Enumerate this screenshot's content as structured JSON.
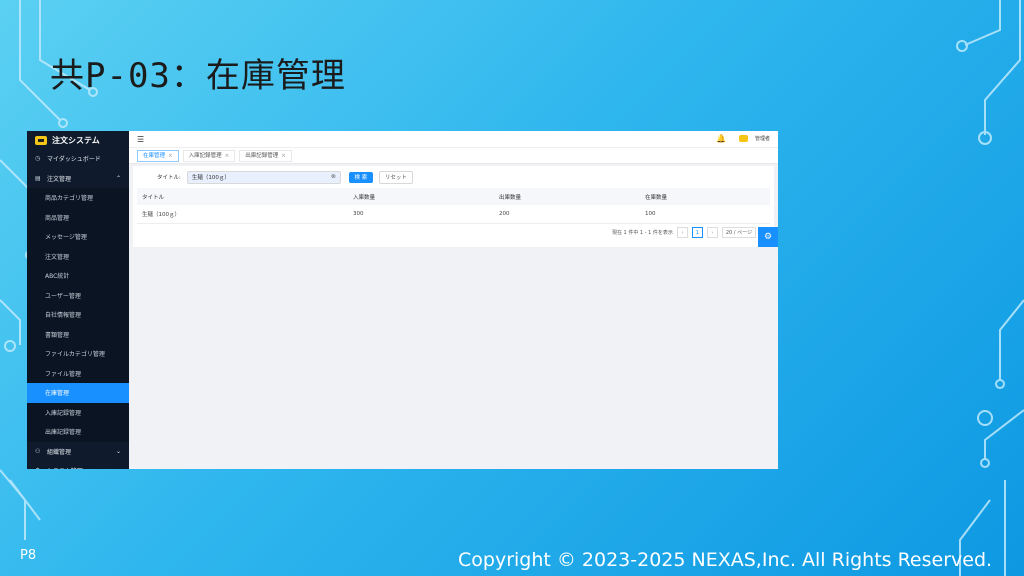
{
  "slide": {
    "title": "共P-03：在庫管理",
    "page_number": "P8",
    "copyright": "Copyright © 2023-2025 NEXAS,Inc. All Rights Reserved."
  },
  "sidebar": {
    "brand": "注文システム",
    "items": [
      {
        "label": "マイダッシュボード",
        "type": "parent",
        "icon": "dashboard-icon",
        "glyph": "◷"
      },
      {
        "label": "注文管理",
        "type": "parent",
        "icon": "document-icon",
        "glyph": "▤",
        "arrow": "⌃"
      },
      {
        "label": "商品カテゴリ管理",
        "type": "sub"
      },
      {
        "label": "商品管理",
        "type": "sub"
      },
      {
        "label": "メッセージ管理",
        "type": "sub"
      },
      {
        "label": "注文管理",
        "type": "sub"
      },
      {
        "label": "ABC統計",
        "type": "sub"
      },
      {
        "label": "ユーザー管理",
        "type": "sub"
      },
      {
        "label": "自社情報管理",
        "type": "sub"
      },
      {
        "label": "書類管理",
        "type": "sub"
      },
      {
        "label": "ファイルカテゴリ管理",
        "type": "sub"
      },
      {
        "label": "ファイル管理",
        "type": "sub"
      },
      {
        "label": "在庫管理",
        "type": "sub",
        "active": true
      },
      {
        "label": "入庫記録管理",
        "type": "sub"
      },
      {
        "label": "出庫記録管理",
        "type": "sub"
      },
      {
        "label": "組織管理",
        "type": "parent",
        "icon": "org-icon",
        "glyph": "⚇",
        "arrow": "⌄"
      },
      {
        "label": "システム管理",
        "type": "parent",
        "icon": "gear-icon",
        "glyph": "⚙",
        "arrow": "⌄"
      }
    ]
  },
  "topbar": {
    "fold_glyph": "☰",
    "bell_glyph": "🔔",
    "user": "管理者"
  },
  "tabs": [
    {
      "label": "在庫管理",
      "active": true
    },
    {
      "label": "入庫記録管理",
      "active": false
    },
    {
      "label": "出庫記録管理",
      "active": false
    }
  ],
  "search": {
    "label": "タイトル:",
    "value": "生麺（100ｇ）",
    "clear_glyph": "⊗",
    "search_button": "検 索",
    "reset_button": "リセット"
  },
  "table": {
    "headers": [
      "タイトル",
      "入庫数量",
      "出庫数量",
      "在庫数量"
    ],
    "rows": [
      [
        "生麺（100ｇ）",
        "300",
        "200",
        "100"
      ]
    ]
  },
  "pagination": {
    "summary": "現在 1 件中 1 - 1 件を表示",
    "current_page": "1",
    "page_size": "20 / ページ",
    "prev": "‹",
    "next": "›"
  },
  "float_button_glyph": "⚙",
  "colors": {
    "accent": "#1890ff",
    "sidebar_bg": "#0f1b2d"
  }
}
